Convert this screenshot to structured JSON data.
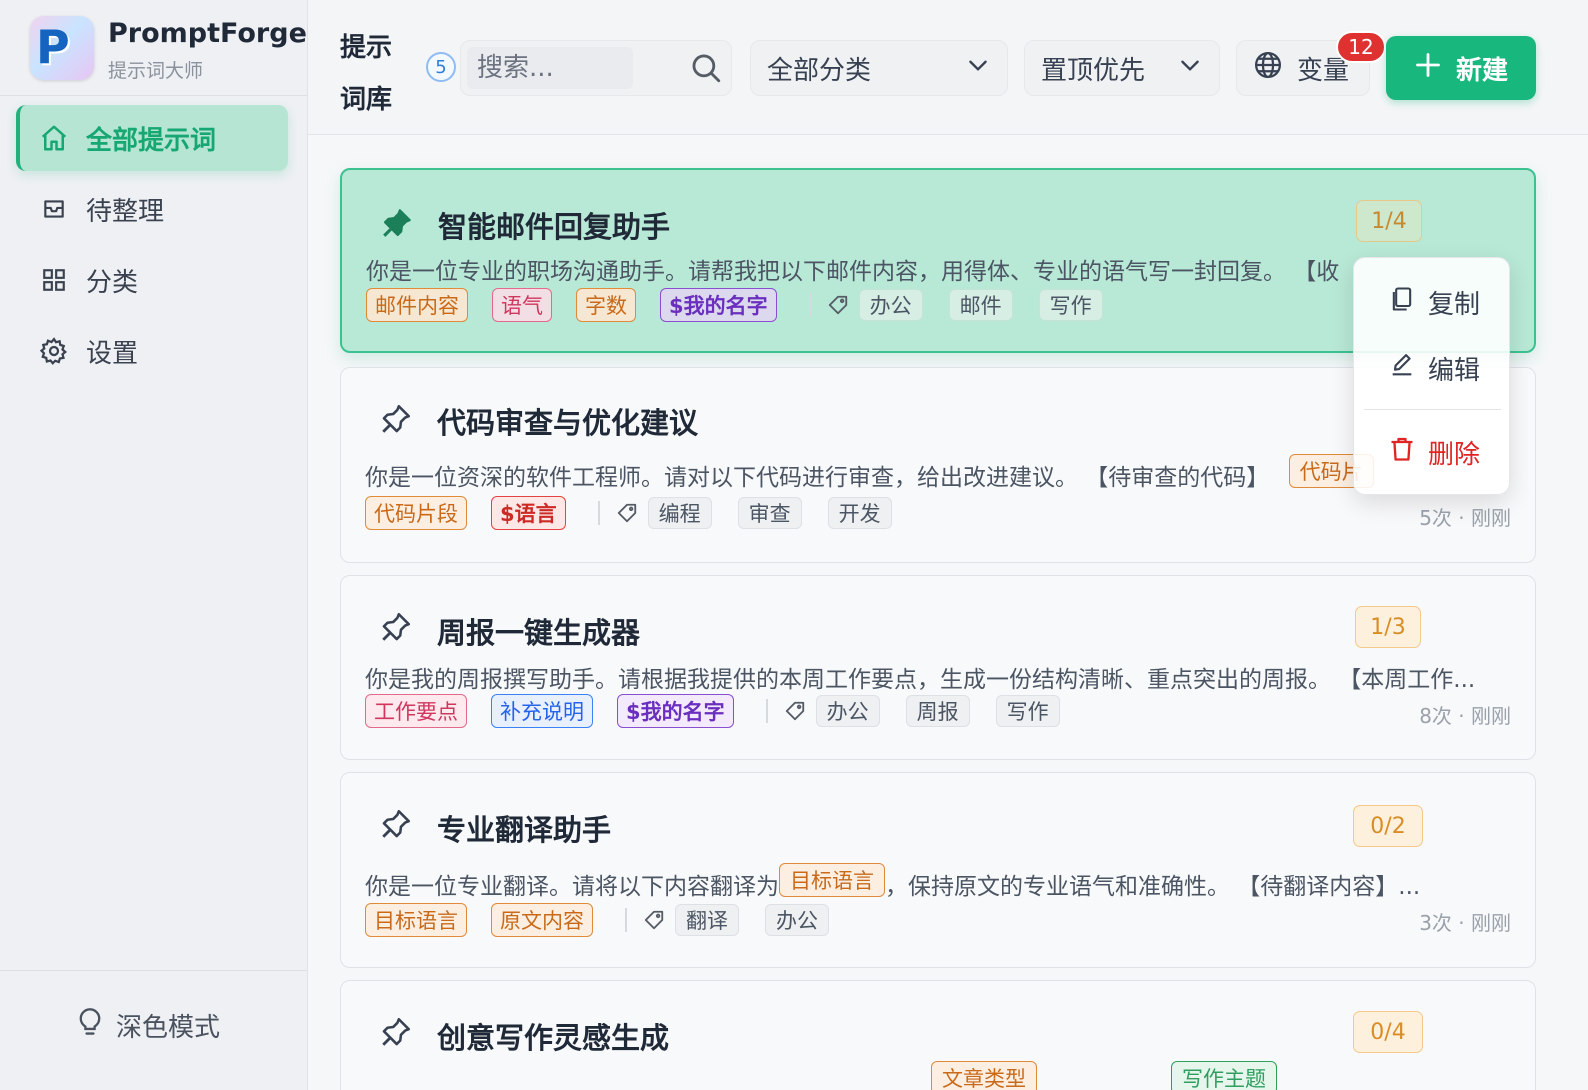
{
  "app": {
    "name": "PromptForge",
    "subtitle": "提示词大师"
  },
  "sidebar": {
    "items": [
      {
        "label": "全部提示词",
        "icon": "home-icon",
        "active": true
      },
      {
        "label": "待整理",
        "icon": "inbox-icon",
        "active": false
      },
      {
        "label": "分类",
        "icon": "grid-icon",
        "active": false
      },
      {
        "label": "设置",
        "icon": "gear-icon",
        "active": false
      }
    ],
    "dark_mode_label": "深色模式"
  },
  "header": {
    "title": "提示词库",
    "count": "5",
    "search_placeholder": "搜索...",
    "category_select": "全部分类",
    "sort_select": "置顶优先",
    "variables_label": "变量",
    "variables_count": "12",
    "new_button": "新建"
  },
  "cards": [
    {
      "title": "智能邮件回复助手",
      "pinned": true,
      "selected": true,
      "progress": "1/4",
      "description": "你是一位专业的职场沟通助手。请帮我把以下邮件内容，用得体、专业的语气写一封回复。 【收",
      "variables": [
        {
          "label": "邮件内容",
          "color": "orange"
        },
        {
          "label": "语气",
          "color": "pink"
        },
        {
          "label": "字数",
          "color": "orange"
        },
        {
          "label": "$我的名字",
          "color": "purple"
        }
      ],
      "tags": [
        "办公",
        "邮件",
        "写作"
      ],
      "meta": ""
    },
    {
      "title": "代码审查与优化建议",
      "pinned": false,
      "selected": false,
      "progress": "",
      "description": "你是一位资深的软件工程师。请对以下代码进行审查，给出改进建议。 【待审查的代码】",
      "inline_tag": "代码片",
      "variables": [
        {
          "label": "代码片段",
          "color": "orange"
        },
        {
          "label": "$语言",
          "color": "red"
        }
      ],
      "tags": [
        "编程",
        "审查",
        "开发"
      ],
      "meta": "5次 · 刚刚"
    },
    {
      "title": "周报一键生成器",
      "pinned": false,
      "selected": false,
      "progress": "1/3",
      "description": "你是我的周报撰写助手。请根据我提供的本周工作要点，生成一份结构清晰、重点突出的周报。 【本周工作...",
      "variables": [
        {
          "label": "工作要点",
          "color": "pink"
        },
        {
          "label": "补充说明",
          "color": "blue"
        },
        {
          "label": "$我的名字",
          "color": "purple"
        }
      ],
      "tags": [
        "办公",
        "周报",
        "写作"
      ],
      "meta": "8次 · 刚刚"
    },
    {
      "title": "专业翻译助手",
      "pinned": false,
      "selected": false,
      "progress": "0/2",
      "description_before": "你是一位专业翻译。请将以下内容翻译为",
      "inline_tag": "目标语言",
      "description_after": "，保持原文的专业语气和准确性。 【待翻译内容】...",
      "variables": [
        {
          "label": "目标语言",
          "color": "orange"
        },
        {
          "label": "原文内容",
          "color": "orange"
        }
      ],
      "tags": [
        "翻译",
        "办公"
      ],
      "meta": "3次 · 刚刚"
    },
    {
      "title": "创意写作灵感生成",
      "pinned": false,
      "selected": false,
      "progress": "0/4",
      "inline_tags": [
        "文章类型",
        "写作主题"
      ]
    }
  ],
  "context_menu": {
    "copy": "复制",
    "edit": "编辑",
    "delete": "删除"
  },
  "colors": {
    "accent": "#17b77e",
    "danger": "#e02424",
    "badge": "#e03131"
  }
}
